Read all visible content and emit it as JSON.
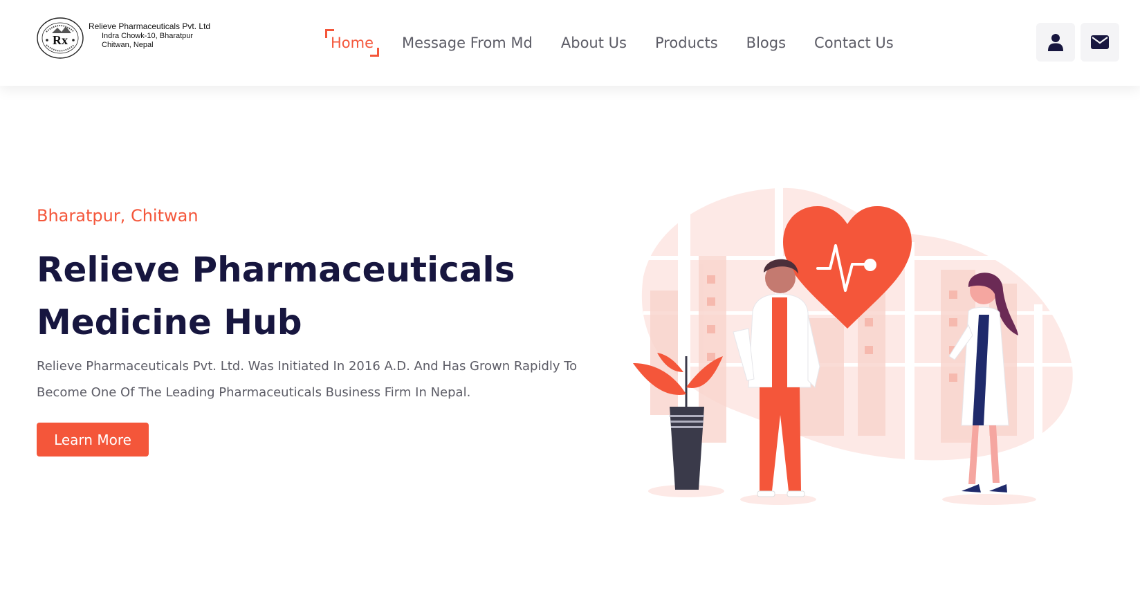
{
  "brand": {
    "name_line": "Relieve Pharmaceuticals Pvt. Ltd",
    "address_line1": "Indra Chowk-10, Bharatpur",
    "address_line2": "Chitwan, Nepal",
    "seal_mark": "Rx"
  },
  "nav": {
    "items": [
      {
        "label": "Home",
        "active": true
      },
      {
        "label": "Message From Md",
        "active": false
      },
      {
        "label": "About Us",
        "active": false
      },
      {
        "label": "Products",
        "active": false
      },
      {
        "label": "Blogs",
        "active": false
      },
      {
        "label": "Contact Us",
        "active": false
      }
    ]
  },
  "header_actions": {
    "user_icon": "user-icon",
    "mail_icon": "mail-icon"
  },
  "hero": {
    "subtitle": "Bharatpur, Chitwan",
    "title_line1": "Relieve Pharmaceuticals",
    "title_line2": "Medicine Hub",
    "description": "Relieve Pharmaceuticals Pvt. Ltd. Was Initiated In 2016 A.D. And Has Grown Rapidly To Become One Of The Leading Pharmaceuticals Business Firm In Nepal.",
    "cta_label": "Learn More"
  },
  "colors": {
    "accent": "#f4563a",
    "heading": "#17163f",
    "body_text": "#5c5c66",
    "icon_bg": "#f4f4f6"
  }
}
